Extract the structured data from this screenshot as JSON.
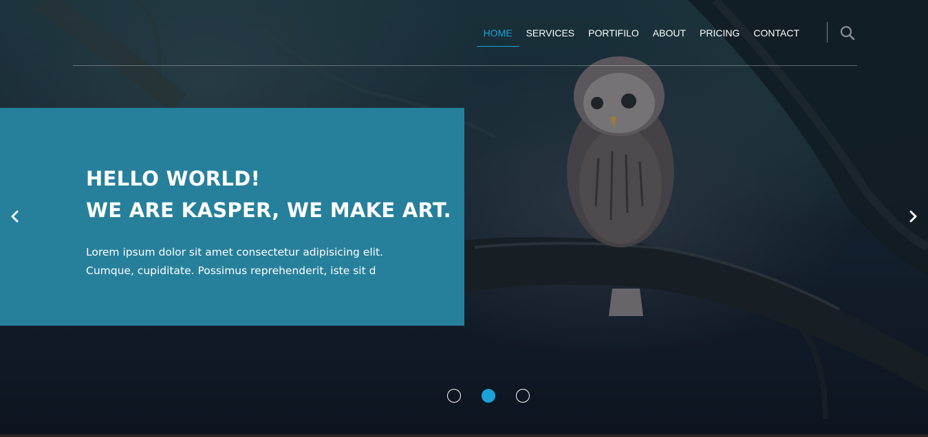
{
  "nav": {
    "items": [
      {
        "label": "HOME",
        "active": true
      },
      {
        "label": "SERVICES",
        "active": false
      },
      {
        "label": "PORTIFILO",
        "active": false
      },
      {
        "label": "ABOUT",
        "active": false
      },
      {
        "label": "PRICING",
        "active": false
      },
      {
        "label": "CONTACT",
        "active": false
      }
    ],
    "search_icon": "search-icon"
  },
  "hero": {
    "headline_line1": "HELLO WORLD!",
    "headline_line2": "WE ARE KASPER, WE MAKE ART.",
    "paragraph": "Lorem ipsum dolor sit amet consectetur adipisicing elit. Cumque, cupiditate. Possimus reprehenderit, iste sit d",
    "background_image": "owl perched on a tree branch at dusk"
  },
  "slider": {
    "prev_icon": "chevron-left-icon",
    "next_icon": "chevron-right-icon",
    "dots": [
      {
        "active": false
      },
      {
        "active": true
      },
      {
        "active": false
      }
    ]
  },
  "colors": {
    "accent": "#1aa2d8",
    "content_box": "#27809b",
    "text": "#ffffff"
  }
}
